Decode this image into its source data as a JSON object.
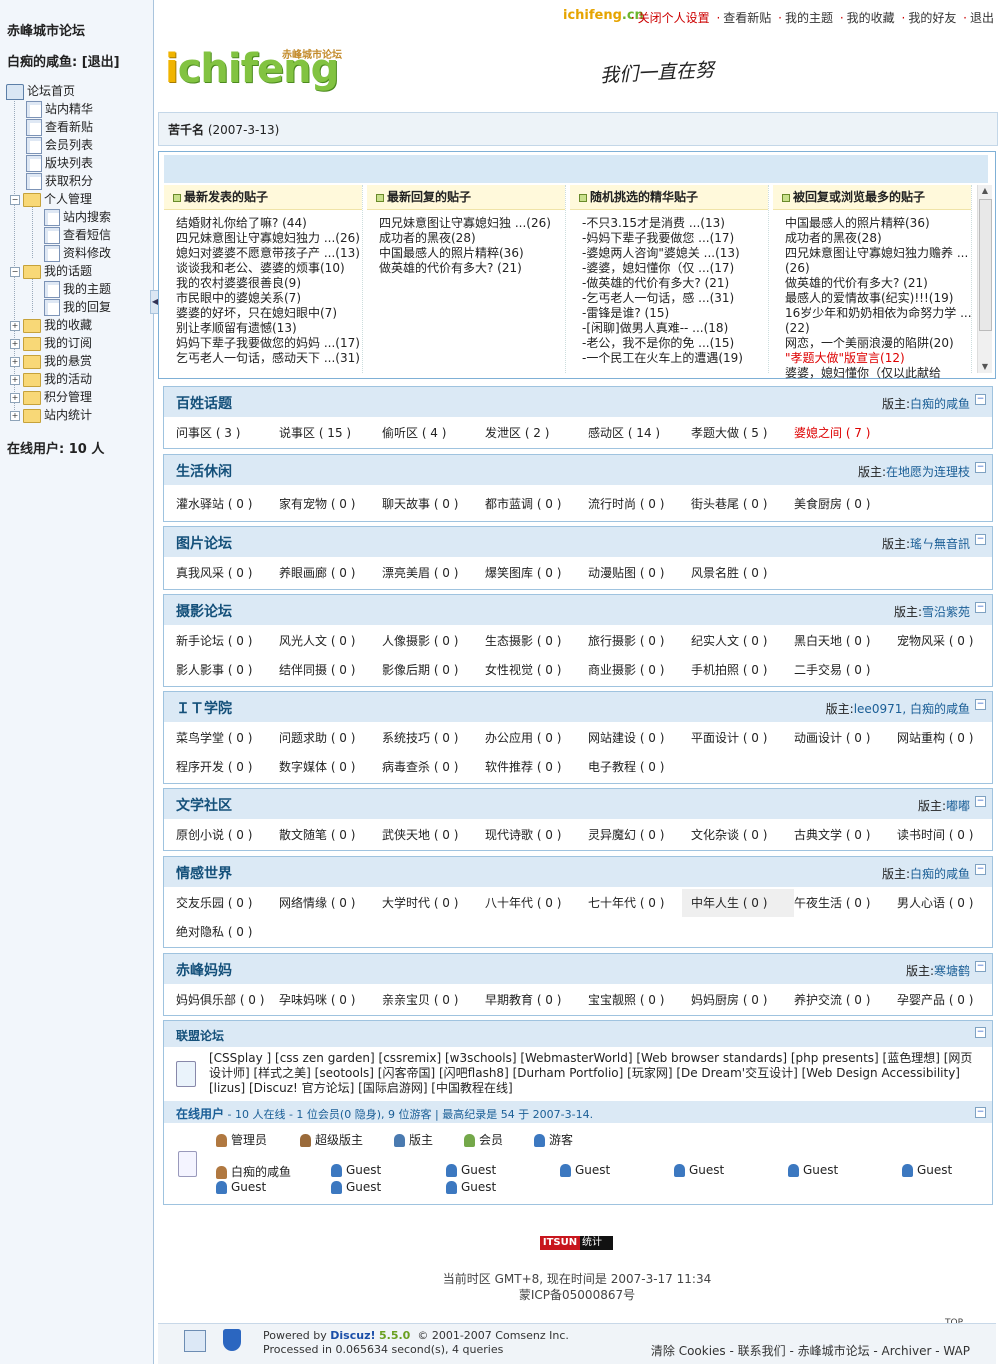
{
  "sidebar": {
    "site_title": "赤峰城市论坛",
    "user": "白痴的咸鱼: [退出]",
    "online": "在线用户: 10 人",
    "tree": [
      {
        "label": "论坛首页"
      },
      {
        "label": "站内精华"
      },
      {
        "label": "查看新贴"
      },
      {
        "label": "会员列表"
      },
      {
        "label": "版块列表"
      },
      {
        "label": "获取积分"
      },
      {
        "label": "个人管理"
      },
      {
        "label": "站内搜索"
      },
      {
        "label": "查看短信"
      },
      {
        "label": "资料修改"
      },
      {
        "label": "我的话题"
      },
      {
        "label": "我的主题"
      },
      {
        "label": "我的回复"
      },
      {
        "label": "我的收藏"
      },
      {
        "label": "我的订阅"
      },
      {
        "label": "我的悬赏"
      },
      {
        "label": "我的活动"
      },
      {
        "label": "积分管理"
      },
      {
        "label": "站内统计"
      }
    ]
  },
  "topbar": {
    "logo_a": "ichifeng",
    "logo_b": ".cn",
    "links": [
      "关闭个人设置",
      "查看新贴",
      "我的主题",
      "我的收藏",
      "我的好友",
      "退出"
    ]
  },
  "header": {
    "logo_sub": "赤峰城市论坛",
    "logo_i": "i",
    "logo_rest": "chifeng",
    "slogan": "我们一直在努"
  },
  "navbar": {
    "name": "苦千名",
    "date": "(2007-3-13)"
  },
  "hot": {
    "columns": [
      {
        "title": "最新发表的贴子",
        "items": [
          "结婚财礼你给了嘛? (44)",
          "四兄妹意图让守寡媳妇独力 ...(26)",
          "媳妇对婆婆不愿意带孩子产 ...(13)",
          "谈谈我和老公、婆婆的烦事(10)",
          "我的农村婆婆很善良(9)",
          "市民眼中的婆媳关系(7)",
          "婆婆的好坏，只在媳妇眼中(7)",
          "别让孝顺留有遗憾(13)",
          "妈妈下辈子我要做您的妈妈 ...(17)",
          "乞丐老人一句话，感动天下 ...(31)"
        ]
      },
      {
        "title": "最新回复的贴子",
        "items": [
          "四兄妹意图让守寡媳妇独 ...(26)",
          "成功者的黑夜(28)",
          "中国最感人的照片精粹(36)",
          "做英雄的代价有多大? (21)"
        ]
      },
      {
        "title": "随机挑选的精华贴子",
        "items": [
          "-不只3.15才是消费 ...(13)",
          "-妈妈下辈子我要做您 ...(17)",
          "-婆媳两人咨询\"婆媳关 ...(13)",
          "-婆婆，媳妇懂你（仅 ...(17)",
          "-做英雄的代价有多大? (21)",
          "-乞丐老人一句话，感 ...(31)",
          "-雷锋是谁? (15)",
          "-[闲聊]做男人真难-- ...(18)",
          "-老公，我不是你的免 ...(15)",
          "-一个民工在火车上的遭遇(19)"
        ]
      },
      {
        "title": "被回复或浏览最多的贴子",
        "items": [
          "中国最感人的照片精粹(36)",
          "成功者的黑夜(28)",
          "四兄妹意图让守寡媳妇独力赡养 ...",
          "(26)",
          "做英雄的代价有多大? (21)",
          "最感人的爱情故事(纪实)!!!(19)",
          "16岁少年和奶奶相依为命努力学 ...",
          "(22)",
          "网恋，一个美丽浪漫的陷阱(20)",
          "\"孝题大做\"版宣言(12)",
          "婆婆，媳妇懂你（仅以此献给"
        ]
      }
    ]
  },
  "forums": [
    {
      "name": "百姓话题",
      "mod_label": "版主:",
      "mod": "白痴的咸鱼",
      "subs": [
        "问事区 ( 3 )",
        "说事区 ( 15 )",
        "偷听区 ( 4 )",
        "发泄区 ( 2 )",
        "感动区 ( 14 )",
        "孝题大做 ( 5 )",
        "婆媳之间 ( 7 )"
      ]
    },
    {
      "name": "生活休闲",
      "mod_label": "版主:",
      "mod": "在地愿为连理枝",
      "subs": [
        "灌水驿站 ( 0 )",
        "家有宠物 ( 0 )",
        "聊天故事 ( 0 )",
        "都市蓝调 ( 0 )",
        "流行时尚 ( 0 )",
        "街头巷尾 ( 0 )",
        "美食厨房 ( 0 )"
      ]
    },
    {
      "name": "图片论坛",
      "mod_label": "版主:",
      "mod": "瑤ㄣ無音訊",
      "subs": [
        "真我风采 ( 0 )",
        "养眼画廊 ( 0 )",
        "漂亮美眉 ( 0 )",
        "爆笑图库 ( 0 )",
        "动漫贴图 ( 0 )",
        "风景名胜 ( 0 )"
      ]
    },
    {
      "name": "摄影论坛",
      "mod_label": "版主:",
      "mod": "雪沿紫苑",
      "subs": [
        "新手论坛 ( 0 )",
        "风光人文 ( 0 )",
        "人像摄影 ( 0 )",
        "生态摄影 ( 0 )",
        "旅行摄影 ( 0 )",
        "纪实人文 ( 0 )",
        "黑白天地 ( 0 )",
        "宠物风采 ( 0 )",
        "影人影事 ( 0 )",
        "结伴同摄 ( 0 )",
        "影像后期 ( 0 )",
        "女性视觉 ( 0 )",
        "商业摄影 ( 0 )",
        "手机拍照 ( 0 )",
        "二手交易 ( 0 )"
      ]
    },
    {
      "name": "ＩＴ学院",
      "mod_label": "版主:",
      "mod": "lee0971, 白痴的咸鱼",
      "subs": [
        "菜鸟学堂 ( 0 )",
        "问题求助 ( 0 )",
        "系统技巧 ( 0 )",
        "办公应用 ( 0 )",
        "网站建设 ( 0 )",
        "平面设计 ( 0 )",
        "动画设计 ( 0 )",
        "网站重构 ( 0 )",
        "程序开发 ( 0 )",
        "数字媒体 ( 0 )",
        "病毒查杀 ( 0 )",
        "软件推荐 ( 0 )",
        "电子教程 ( 0 )"
      ]
    },
    {
      "name": "文学社区",
      "mod_label": "版主:",
      "mod": "嘟嘟",
      "subs": [
        "原创小说 ( 0 )",
        "散文随笔 ( 0 )",
        "武侠天地 ( 0 )",
        "现代诗歌 ( 0 )",
        "灵异魔幻 ( 0 )",
        "文化杂谈 ( 0 )",
        "古典文学 ( 0 )",
        "读书时间 ( 0 )"
      ]
    },
    {
      "name": "情感世界",
      "mod_label": "版主:",
      "mod": "白痴的咸鱼",
      "subs": [
        "交友乐园 ( 0 )",
        "网络情缘 ( 0 )",
        "大学时代 ( 0 )",
        "八十年代 ( 0 )",
        "七十年代 ( 0 )",
        "中年人生 ( 0 )",
        "午夜生活 ( 0 )",
        "男人心语 ( 0 )",
        "绝对隐私 ( 0 )"
      ]
    },
    {
      "name": "赤峰妈妈",
      "mod_label": "版主:",
      "mod": "寒塘鹤",
      "subs": [
        "妈妈俱乐部 ( 0 )",
        "孕味妈咪 ( 0 )",
        "亲亲宝贝 ( 0 )",
        "早期教育 ( 0 )",
        "宝宝靓照 ( 0 )",
        "妈妈厨房 ( 0 )",
        "养护交流 ( 0 )",
        "孕婴产品 ( 0 )"
      ]
    }
  ],
  "union": {
    "title": "联盟论坛",
    "links": "[CSSplay ] [css zen garden] [cssremix] [w3schools] [WebmasterWorld] [Web browser standards] [php presents] [蓝色理想] [网页设计师] [样式之美] [seotools] [闪客帝国] [闪吧flash8] [Durham Portfolio] [玩家网] [De Dream'交互设计] [Web Design Accessibility] [lizus] [Discuz! 官方论坛] [国际启游网] [中国教程在线]"
  },
  "online": {
    "label": "在线用户",
    "summary": "- 10 人在线  - 1 位会员(0 隐身), 9 位游客 | 最高纪录是 54 于 2007-3-14.",
    "legend": [
      "管理员",
      "超级版主",
      "版主",
      "会员",
      "游客"
    ],
    "users": [
      "白痴的咸鱼",
      "Guest",
      "Guest",
      "Guest",
      "Guest",
      "Guest",
      "Guest",
      "Guest",
      "Guest",
      "Guest"
    ]
  },
  "footer": {
    "stat_a": "ITSUN",
    "stat_b": "统计",
    "time": "当前时区 GMT+8, 现在时间是 2007-3-17 11:34",
    "icp": "蒙ICP备05000867号",
    "top": "TOP",
    "powered": "Powered by",
    "discuz": "Discuz!",
    "version": "5.5.0",
    "copyright": "© 2001-2007 Comsenz Inc.",
    "processed": "Processed in 0.065634 second(s), 4 queries",
    "links": "清除 Cookies - 联系我们 - 赤峰城市论坛 - Archiver - WAP"
  }
}
